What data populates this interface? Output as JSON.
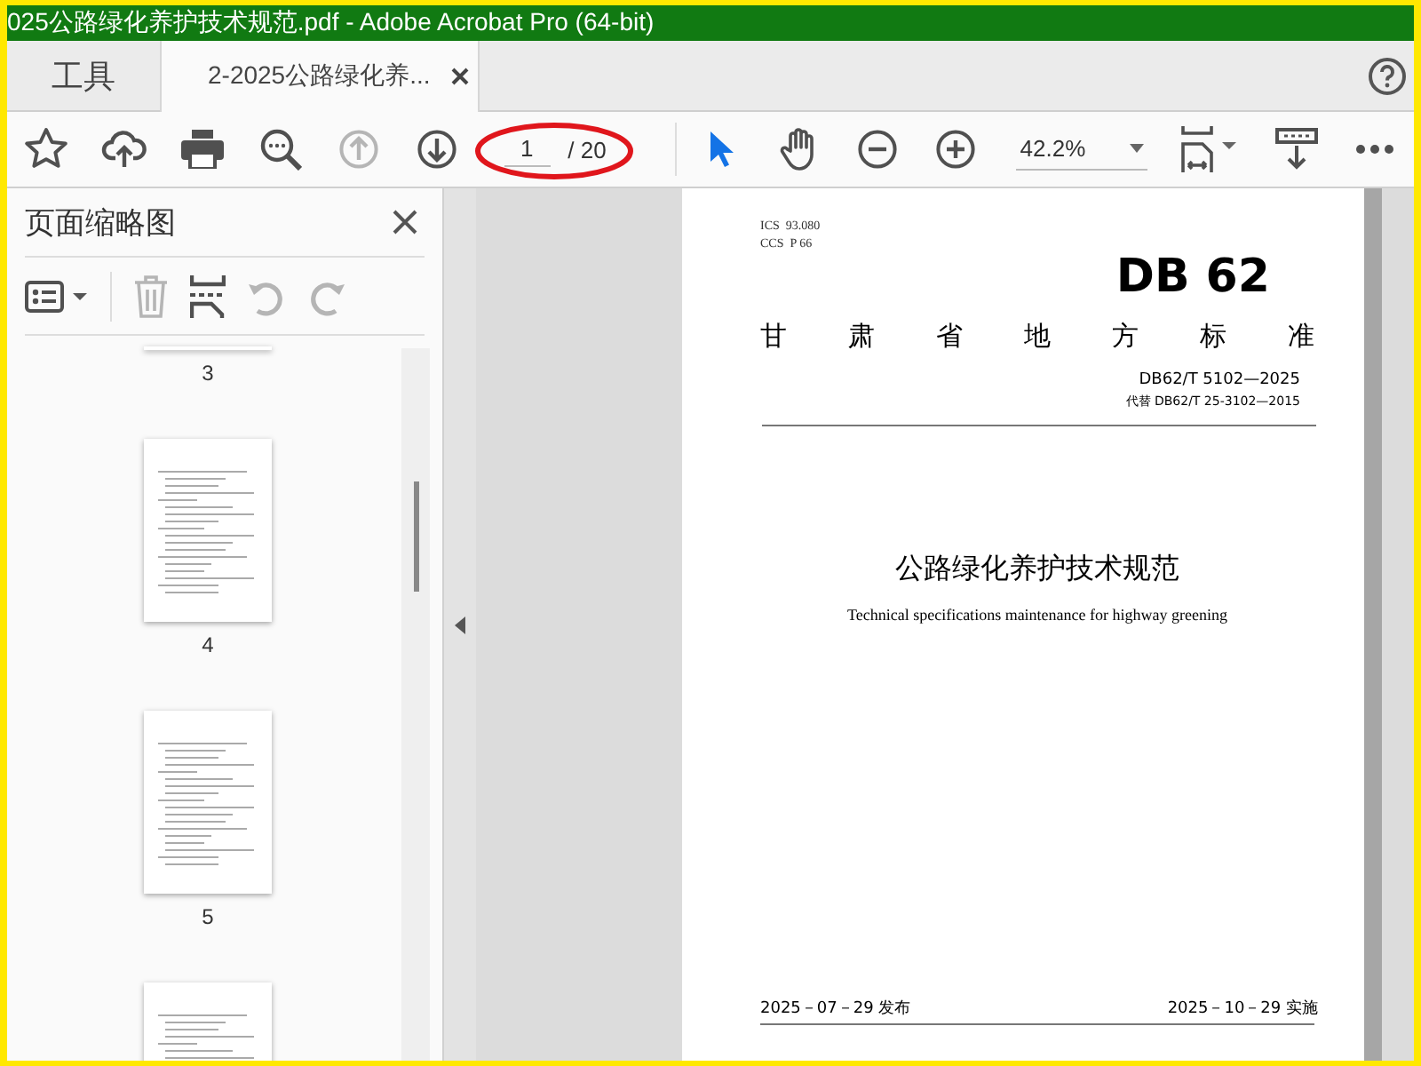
{
  "window": {
    "title": "025公路绿化养护技术规范.pdf - Adobe Acrobat Pro (64-bit)"
  },
  "tabs": [
    {
      "kind": "home",
      "label": "工具",
      "selected": false
    },
    {
      "kind": "document",
      "label": "2-2025公路绿化养...",
      "selected": true
    }
  ],
  "toolbar": [
    {
      "kind": "bookmark",
      "disabled": false
    },
    {
      "kind": "upload",
      "disabled": false
    },
    {
      "kind": "print",
      "disabled": false
    },
    {
      "kind": "zoom-search",
      "disabled": false
    },
    {
      "kind": "prev-page",
      "disabled": true
    },
    {
      "kind": "next-page",
      "disabled": false
    },
    {
      "kind": "page-field",
      "value": "1",
      "total": "/ 20"
    },
    {
      "kind": "separator"
    },
    {
      "kind": "select",
      "selected": true
    },
    {
      "kind": "hand",
      "selected": false
    },
    {
      "kind": "zoom-out",
      "disabled": false
    },
    {
      "kind": "zoom-in",
      "disabled": false
    },
    {
      "kind": "zoom-field",
      "value": "42.2%"
    },
    {
      "kind": "fit-page",
      "disabled": false
    },
    {
      "kind": "scroll-mode",
      "disabled": false
    },
    {
      "kind": "more",
      "disabled": false
    }
  ],
  "panel": {
    "title": "页面缩略图",
    "tools": [
      {
        "kind": "view-options",
        "disabled": false
      },
      {
        "kind": "separator"
      },
      {
        "kind": "delete",
        "disabled": true
      },
      {
        "kind": "insert",
        "disabled": false
      },
      {
        "kind": "rotate-ccw",
        "disabled": true
      },
      {
        "kind": "rotate-cw",
        "disabled": true
      }
    ],
    "thumbnails": [
      {
        "kind": "cut-top",
        "label": "3"
      },
      {
        "kind": "full",
        "label": "4"
      },
      {
        "kind": "full",
        "label": "5"
      },
      {
        "kind": "cut-bottom"
      }
    ]
  },
  "document": {
    "ics": "ICS  93.080",
    "ccs": "CCS  P 66",
    "logo": "DB 62",
    "province_title": "甘肃省地方标准",
    "standard_number": "DB62/T 5102—2025",
    "replaces": "代替 DB62/T 25-3102—2015",
    "title_cn": "公路绿化养护技术规范",
    "title_en": "Technical specifications maintenance for highway greening",
    "issue_date": "2025－07－29 发布",
    "effective_date": "2025－10－29 实施"
  }
}
